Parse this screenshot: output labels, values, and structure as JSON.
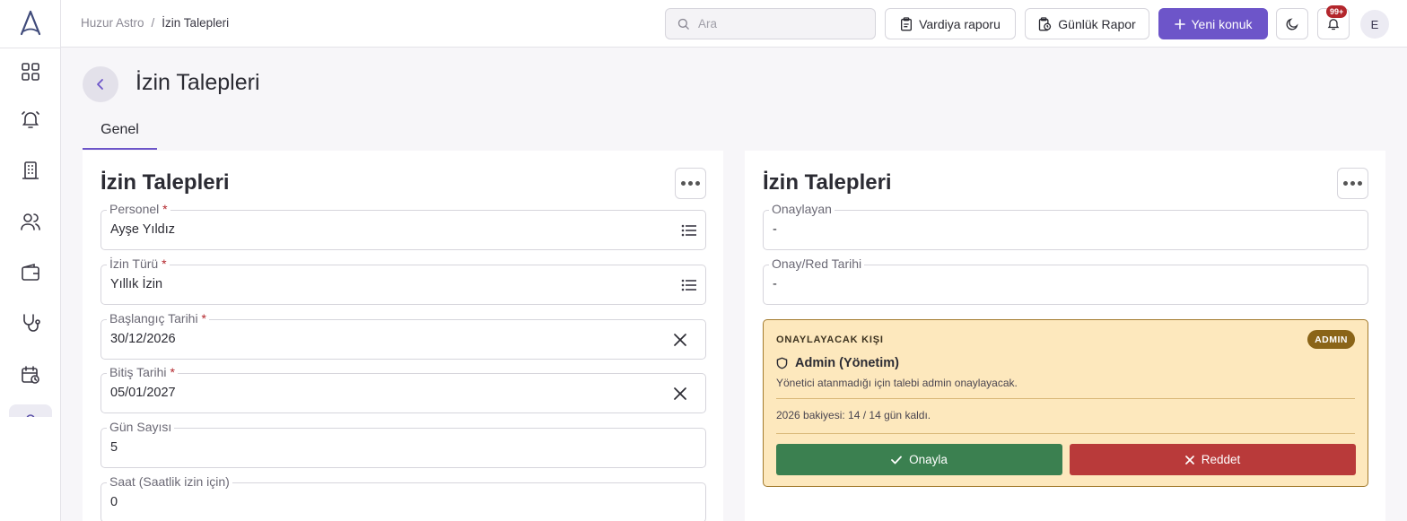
{
  "breadcrumb": {
    "root": "Huzur Astro",
    "separator": "/",
    "current": "İzin Talepleri"
  },
  "header": {
    "search_placeholder": "Ara",
    "shift_report": "Vardiya raporu",
    "daily_report": "Günlük Rapor",
    "new_guest": "Yeni konuk",
    "notification_count": "99+",
    "avatar_initial": "E"
  },
  "sidebar": {
    "icons": [
      "dashboard-icon",
      "alarm-bell-icon",
      "building-icon",
      "users-icon",
      "wallet-icon",
      "stethoscope-icon",
      "calendar-clock-icon",
      "user-icon"
    ]
  },
  "page": {
    "title": "İzin Talepleri",
    "tab": "Genel"
  },
  "left_card": {
    "title": "İzin Talepleri",
    "fields": {
      "personel": {
        "label": "Personel",
        "value": "Ayşe Yıldız",
        "required": "*"
      },
      "izin_turu": {
        "label": "İzin Türü",
        "value": "Yıllık İzin",
        "required": "*"
      },
      "baslangic": {
        "label": "Başlangıç Tarihi",
        "value": "30/12/2026",
        "required": "*"
      },
      "bitis": {
        "label": "Bitiş Tarihi",
        "value": "05/01/2027",
        "required": "*"
      },
      "gun_sayisi": {
        "label": "Gün Sayısı",
        "value": "5"
      },
      "saat": {
        "label": "Saat (Saatlik izin için)",
        "value": "0"
      }
    }
  },
  "right_card": {
    "title": "İzin Talepleri",
    "fields": {
      "onaylayan": {
        "label": "Onaylayan",
        "value": "-"
      },
      "onay_red_tarihi": {
        "label": "Onay/Red Tarihi",
        "value": "-"
      }
    },
    "approval": {
      "heading": "ONAYLAYACAK KIŞI",
      "badge": "ADMIN",
      "approver": "Admin (Yönetim)",
      "description": "Yönetici atanmadığı için talebi admin onaylayacak.",
      "balance": "2026 bakiyesi: 14 / 14 gün kaldı.",
      "approve_label": "Onayla",
      "reject_label": "Reddet"
    }
  },
  "colors": {
    "accent": "#6d55c9",
    "approve": "#3b8050",
    "reject": "#b93a3a",
    "warning_bg": "#fde8bd",
    "admin_badge": "#8a6418"
  }
}
